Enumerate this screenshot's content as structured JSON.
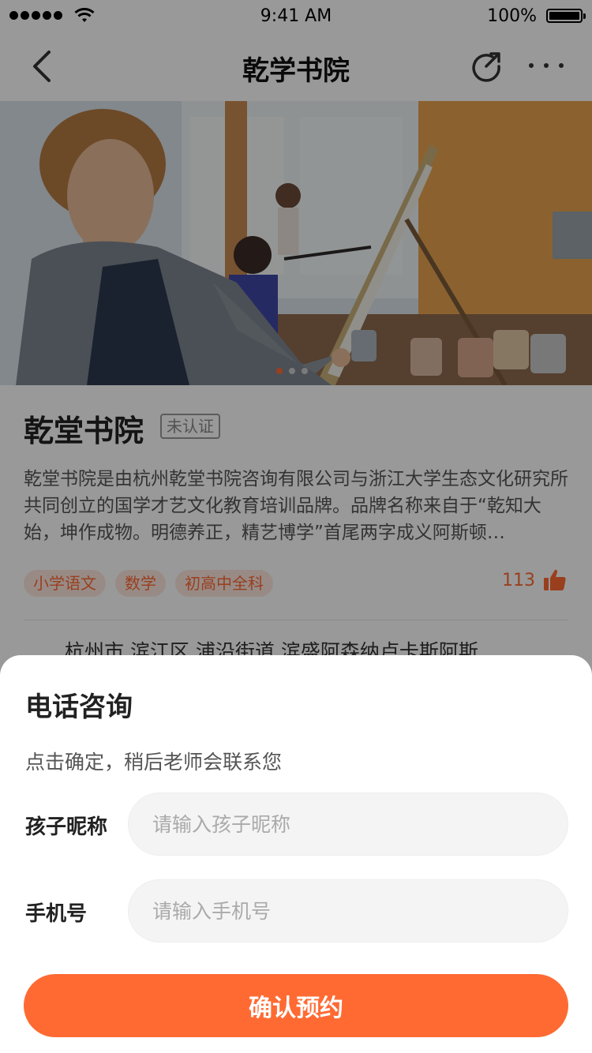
{
  "status_bar": {
    "time": "9:41 AM",
    "battery": "100%"
  },
  "nav": {
    "title": "乾学书院"
  },
  "hero": {
    "slide_count": 3,
    "active_slide": 1
  },
  "school": {
    "name": "乾堂书院",
    "badge": "未认证",
    "description": "乾堂书院是由杭州乾堂书院咨询有限公司与浙江大学生态文化研究所共同创立的国学才艺文化教育培训品牌。品牌名称来自于“乾知大始，坤作成物。明德养正，精艺博学”首尾两字成义阿斯顿…",
    "tags": [
      "小学语文",
      "数学",
      "初高中全科"
    ],
    "likes": "113",
    "address": "杭州市 滨江区 浦沿街道 滨盛阿森纳卢卡斯阿斯"
  },
  "sheet": {
    "title": "电话咨询",
    "subtitle": "点击确定，稍后老师会联系您",
    "fields": [
      {
        "label": "孩子昵称",
        "placeholder": "请输入孩子昵称",
        "value": ""
      },
      {
        "label": "手机号",
        "placeholder": "请输入手机号",
        "value": ""
      }
    ],
    "confirm_label": "确认预约"
  },
  "colors": {
    "accent": "#ff6a33",
    "tag_bg": "#fde8e0",
    "overlay": "rgba(0,0,0,0.4)"
  },
  "icons": [
    "back-arrow-icon",
    "share-icon",
    "more-icon",
    "thumbs-up-icon",
    "wifi-icon",
    "battery-icon"
  ]
}
